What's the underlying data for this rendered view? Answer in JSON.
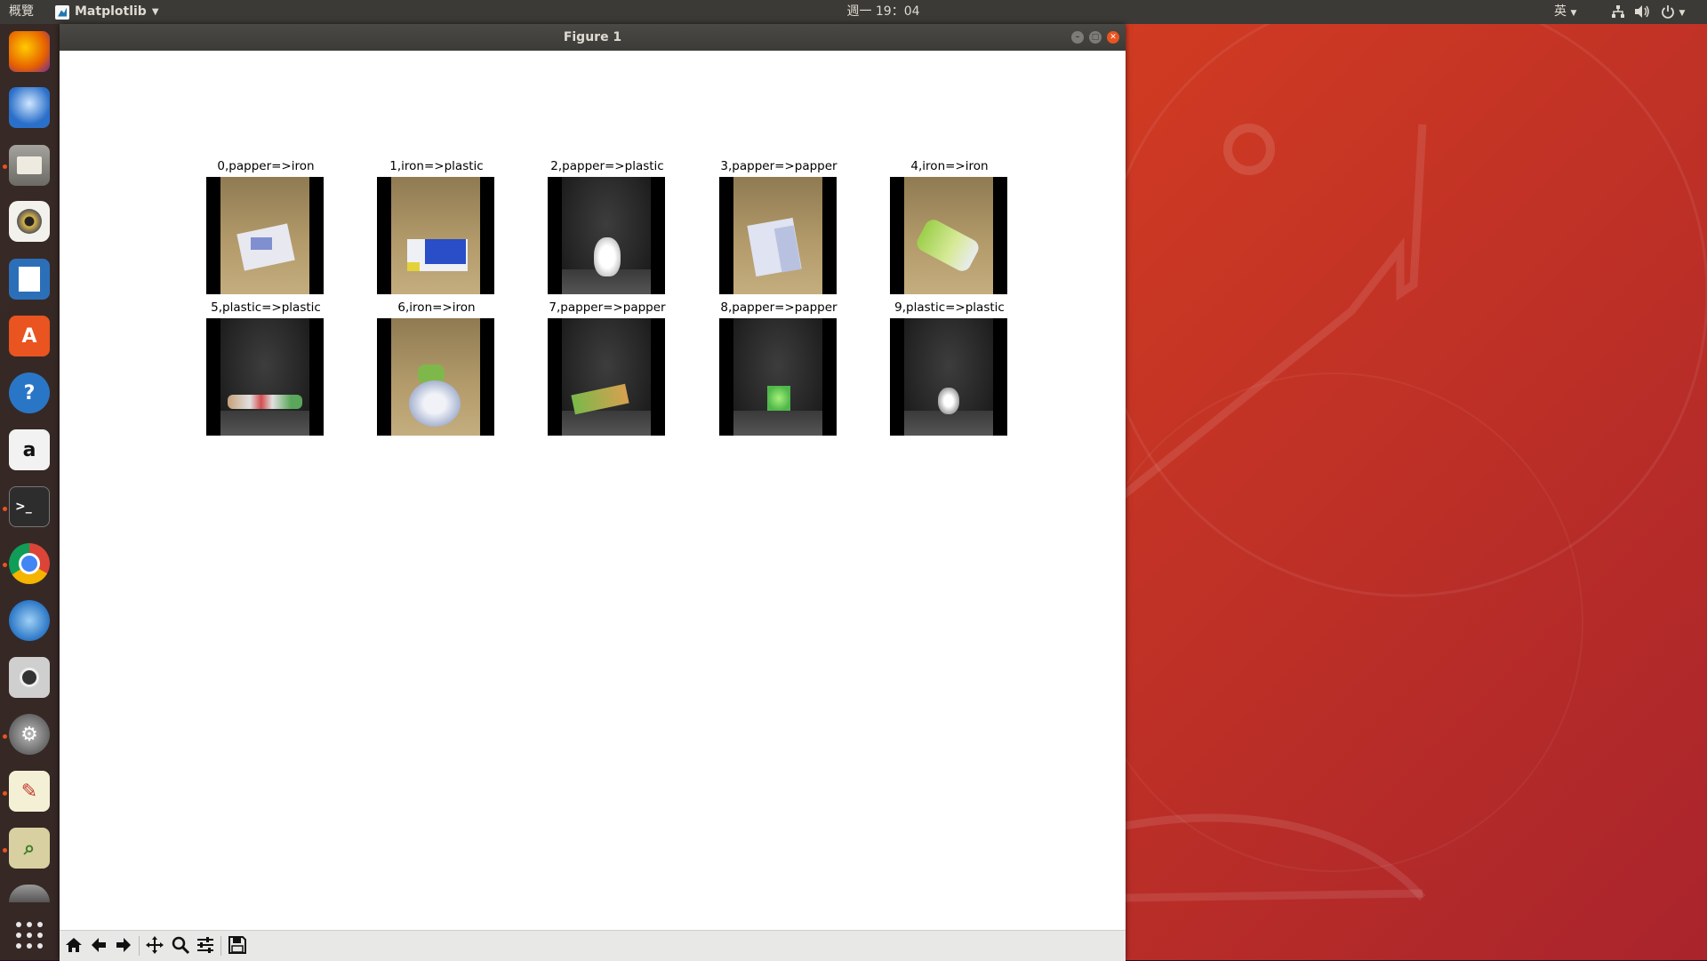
{
  "topbar": {
    "activities": "概覽",
    "app_name": "Matplotlib",
    "clock": "週一 19：04",
    "input_method": "英"
  },
  "dock": {
    "items": [
      {
        "name": "firefox",
        "color": "#e66000"
      },
      {
        "name": "thunderbird",
        "color": "#2a6fc9"
      },
      {
        "name": "files",
        "color": "#8c8a85"
      },
      {
        "name": "rhythmbox",
        "color": "#d9b44a"
      },
      {
        "name": "writer",
        "color": "#2c6fb9"
      },
      {
        "name": "software",
        "color": "#e95420"
      },
      {
        "name": "help",
        "color": "#2a76c6"
      },
      {
        "name": "amazon",
        "color": "#f2f2f2"
      },
      {
        "name": "terminal",
        "color": "#2d2d2d"
      },
      {
        "name": "chrome",
        "color": "#4285f4"
      },
      {
        "name": "shotwell",
        "color": "#3a8fd0"
      },
      {
        "name": "screenshot",
        "color": "#cfcfcf"
      },
      {
        "name": "settings",
        "color": "#7e7e7e"
      },
      {
        "name": "text-editor",
        "color": "#f4f0d6"
      },
      {
        "name": "image-viewer",
        "color": "#d8d0a0"
      },
      {
        "name": "extra",
        "color": "#777"
      },
      {
        "name": "show-apps",
        "color": "transparent"
      }
    ]
  },
  "window": {
    "title": "Figure 1"
  },
  "figure": {
    "subplots": [
      {
        "title": "0,papper=>iron",
        "background": "wood",
        "object": "box-white"
      },
      {
        "title": "1,iron=>plastic",
        "background": "wood",
        "object": "box-blue"
      },
      {
        "title": "2,papper=>plastic",
        "background": "dark",
        "object": "bottle-white"
      },
      {
        "title": "3,papper=>papper",
        "background": "wood",
        "object": "box-lightblue"
      },
      {
        "title": "4,iron=>iron",
        "background": "wood",
        "object": "can-green"
      },
      {
        "title": "5,plastic=>plastic",
        "background": "dark",
        "object": "bottle-lying"
      },
      {
        "title": "6,iron=>iron",
        "background": "wood",
        "object": "can-silver"
      },
      {
        "title": "7,papper=>papper",
        "background": "dark",
        "object": "carton-green"
      },
      {
        "title": "8,papper=>papper",
        "background": "dark",
        "object": "box-green"
      },
      {
        "title": "9,plastic=>plastic",
        "background": "dark",
        "object": "bottle-small"
      }
    ]
  },
  "toolbar": {
    "tools": [
      "home-icon",
      "back-icon",
      "forward-icon",
      "pan-icon",
      "zoom-icon",
      "configure-icon",
      "save-icon"
    ]
  }
}
